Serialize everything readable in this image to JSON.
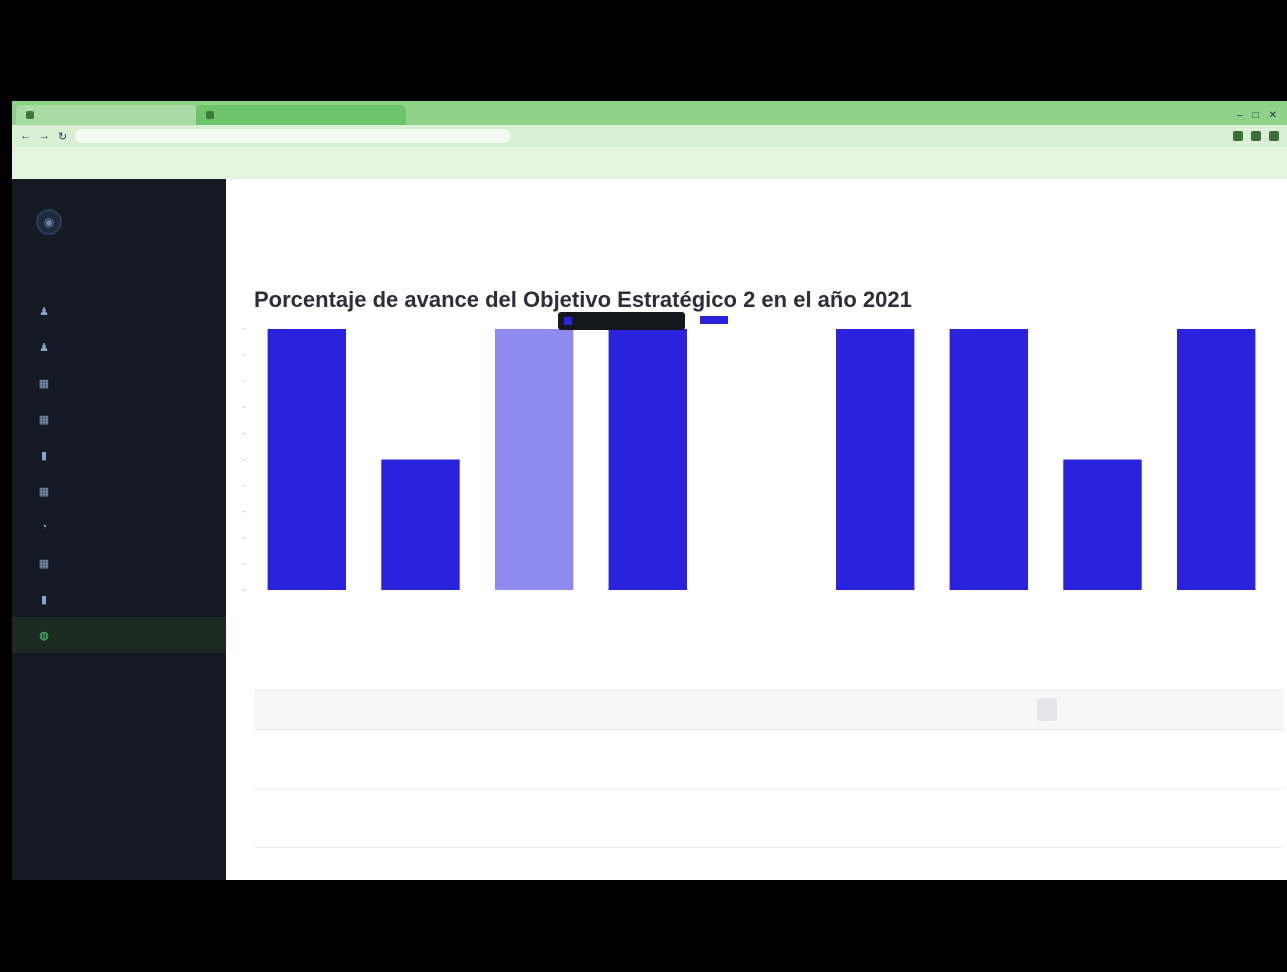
{
  "browser": {
    "tabs": [
      {
        "label": "",
        "active": false
      },
      {
        "label": "",
        "active": true
      }
    ],
    "url": "",
    "bookmarks": [
      "",
      "",
      "",
      "",
      "",
      ""
    ]
  },
  "sidebar": {
    "logo_icon": "circle-logo",
    "items": [
      {
        "label": "",
        "icon": "user-icon"
      },
      {
        "label": "",
        "icon": "user-icon"
      },
      {
        "label": "",
        "icon": "grid-icon"
      },
      {
        "label": "",
        "icon": "grid-icon"
      },
      {
        "label": "",
        "icon": "bar-icon"
      },
      {
        "label": "",
        "icon": "grid-icon"
      },
      {
        "label": "",
        "icon": "chart-icon"
      },
      {
        "label": "",
        "icon": "grid-icon"
      },
      {
        "label": "",
        "icon": "bar-icon"
      },
      {
        "label": "",
        "icon": "globe-icon",
        "active": true
      }
    ]
  },
  "header": {
    "user_link": ""
  },
  "chart_title": "Porcentaje de avance del Objetivo Estratégico 2 en el año 2021",
  "tooltip": {
    "line1": "",
    "line2": ""
  },
  "legend": {
    "label": ""
  },
  "chart_data": {
    "type": "bar",
    "categories": [
      "",
      "",
      "",
      "",
      "",
      "",
      "",
      "",
      ""
    ],
    "values": [
      100,
      50,
      100,
      100,
      0,
      100,
      100,
      50,
      100
    ],
    "highlighted_index": 2,
    "ylim": [
      0,
      100
    ],
    "bar_color": "#2a22dd",
    "highlight_color": "#8f8bee",
    "grid": false
  },
  "table": {
    "headers": [
      "",
      "",
      "",
      ""
    ],
    "rows": [
      {
        "code": "",
        "description": "",
        "v1": "",
        "v2": ""
      },
      {
        "code": "",
        "description": "",
        "v1": "",
        "v2": ""
      }
    ]
  }
}
